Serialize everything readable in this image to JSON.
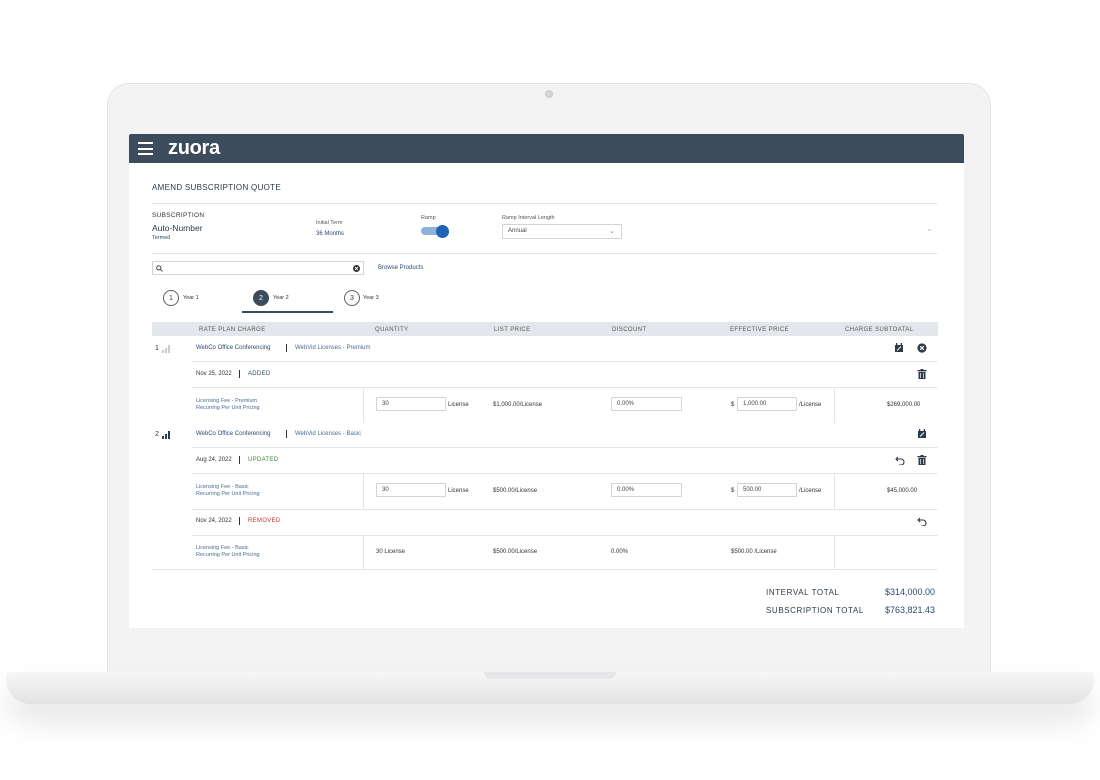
{
  "header": {
    "logo": "zuora"
  },
  "page": {
    "title": "AMEND SUBSCRIPTION QUOTE"
  },
  "subscription": {
    "label": "SUBSCRIPTION",
    "name": "Auto-Number",
    "status": "Termed",
    "initial_term_label": "Initial Term",
    "initial_term_value": "36 Months",
    "ramp_label": "Ramp",
    "ramp_on": true,
    "ramp_interval_label": "Ramp Interval Length",
    "ramp_interval_value": "Annual"
  },
  "search": {
    "placeholder": "",
    "browse_label": "Browse Products"
  },
  "steps": [
    {
      "num": "1",
      "label": "Year 1"
    },
    {
      "num": "2",
      "label": "Year 2"
    },
    {
      "num": "3",
      "label": "Year 3"
    }
  ],
  "table": {
    "headers": [
      "RATE PLAN CHARGE",
      "QUANTITY",
      "LIST PRICE",
      "DISCOUNT",
      "EFFECTIVE PRICE",
      "CHARGE SUBTOATAL"
    ],
    "groups": [
      {
        "index": "1",
        "product": "WebCo Office Conferencing",
        "plan": "WebVid Licenses - Premium",
        "date": "Nov 25, 2022",
        "action": "ADDED",
        "charge_name": "Licensing Fee - Premium",
        "charge_model": "Recurring Per Unit Pricing",
        "quantity": "30",
        "quantity_unit": "License",
        "list_price": "$1,000.00/License",
        "discount": "0.00%",
        "currency": "$",
        "effective_price": "1,000.00",
        "effective_unit": "/License",
        "subtotal": "$269,000.00"
      },
      {
        "index": "2",
        "product": "WebCo Office Conferencing",
        "plan": "WebVid Licenses - Basic",
        "date": "Aug 24, 2022",
        "action": "UPDATED",
        "charge_name": "Licensing Fee - Basic",
        "charge_model": "Recurring Per Unit Pricing",
        "quantity": "30",
        "quantity_unit": "License",
        "list_price": "$500.00/License",
        "discount": "0.00%",
        "currency": "$",
        "effective_price": "500.00",
        "effective_unit": "/License",
        "subtotal": "$45,000.00",
        "removed": {
          "date": "Nov 24, 2022",
          "action": "REMOVED",
          "charge_name": "Licensing Fee - Basic",
          "charge_model": "Recurring Per Unit Pricing",
          "quantity": "30 License",
          "list_price": "$500.00/License",
          "discount": "0.00%",
          "effective_price": "$500.00 /License"
        }
      }
    ]
  },
  "totals": {
    "interval_label": "INTERVAL TOTAL",
    "interval_value": "$314,000.00",
    "subscription_label": "SUBSCRIPTION TOTAL",
    "subscription_value": "$763,821.43"
  },
  "colors": {
    "topbar": "#3c4c5c",
    "added": "#2d4a6e",
    "updated": "#3a8a3a",
    "removed": "#c0392b",
    "toggle": "#1f63b5"
  }
}
